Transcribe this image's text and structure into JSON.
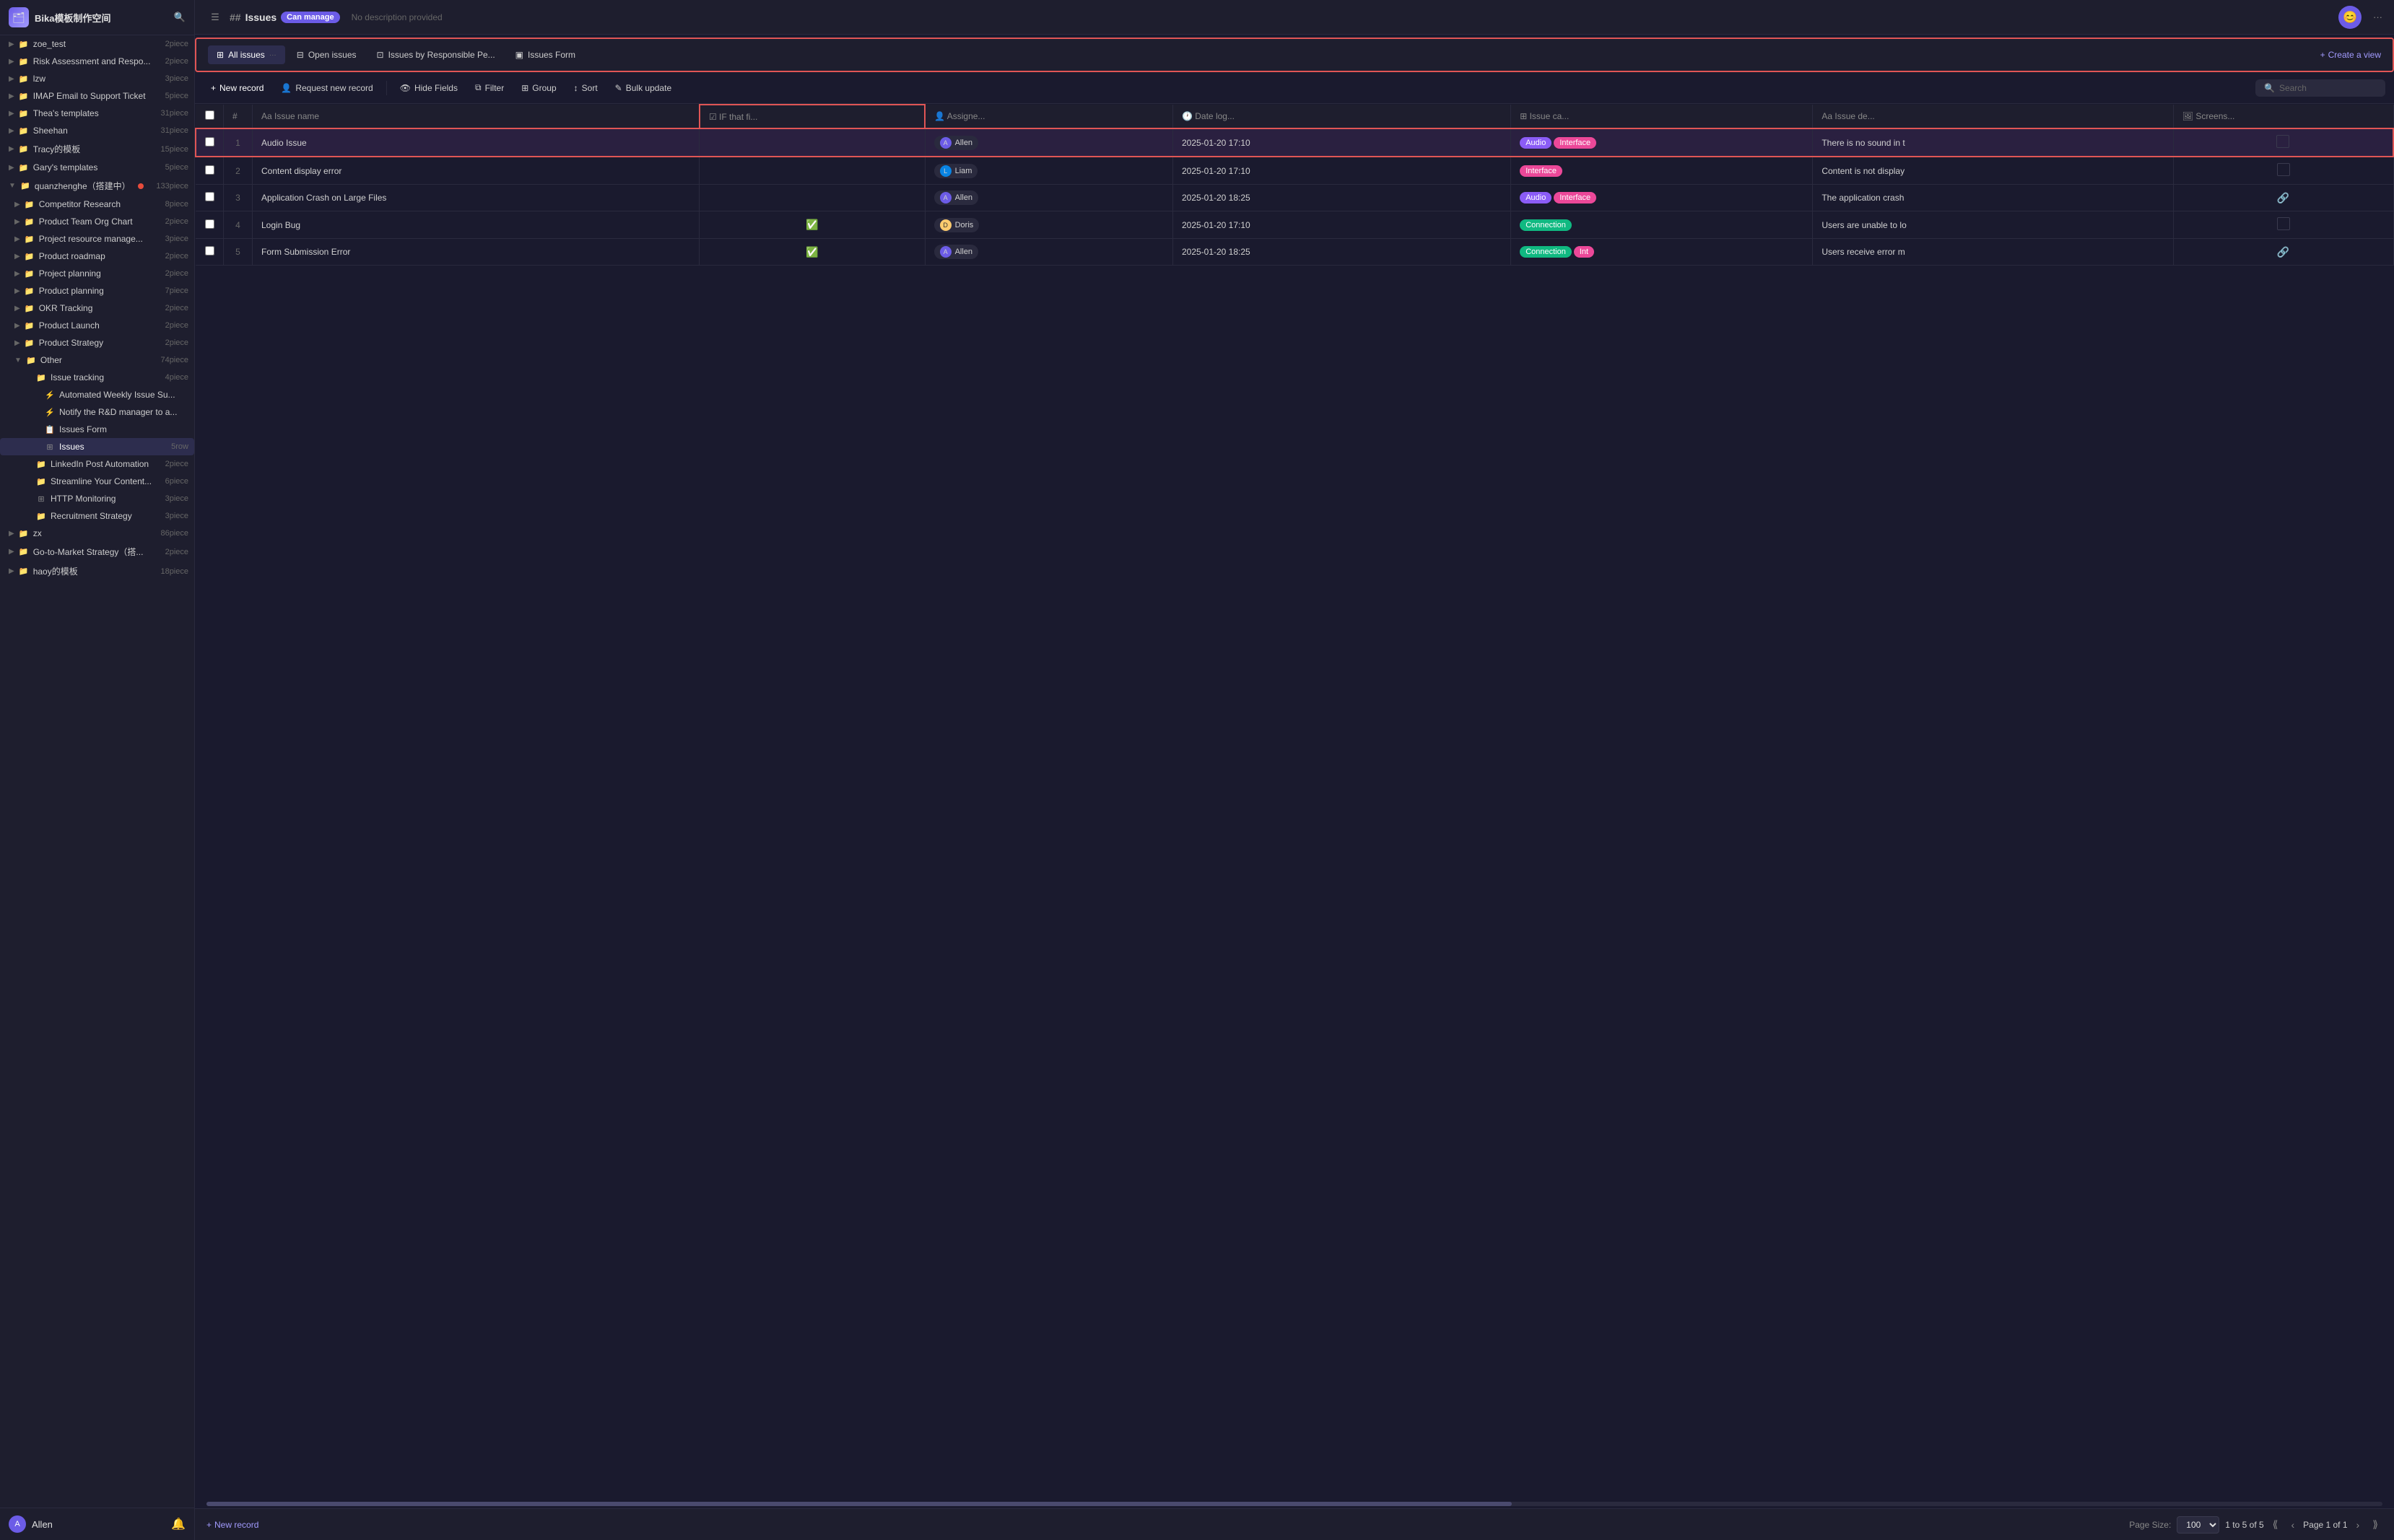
{
  "sidebar": {
    "workspace": "Bika模板制作空间",
    "items": [
      {
        "id": "zoe_test",
        "label": "zoe_test",
        "count": "2piece",
        "indent": 0,
        "icon": "folder"
      },
      {
        "id": "risk",
        "label": "Risk Assessment and Respo...",
        "count": "2piece",
        "indent": 0,
        "icon": "folder"
      },
      {
        "id": "lzw",
        "label": "lzw",
        "count": "3piece",
        "indent": 0,
        "icon": "folder"
      },
      {
        "id": "imap",
        "label": "IMAP Email to Support Ticket",
        "count": "5piece",
        "indent": 0,
        "icon": "folder"
      },
      {
        "id": "thea",
        "label": "Thea's templates",
        "count": "31piece",
        "indent": 0,
        "icon": "folder"
      },
      {
        "id": "sheehan",
        "label": "Sheehan",
        "count": "31piece",
        "indent": 0,
        "icon": "folder"
      },
      {
        "id": "tracy",
        "label": "Tracy的模板",
        "count": "15piece",
        "indent": 0,
        "icon": "folder"
      },
      {
        "id": "gary",
        "label": "Gary's templates",
        "count": "5piece",
        "indent": 0,
        "icon": "folder"
      },
      {
        "id": "quanzhenghe",
        "label": "quanzhenghe（搭建中）",
        "count": "133piece",
        "indent": 0,
        "icon": "folder",
        "expanded": true,
        "dot": true
      },
      {
        "id": "competitor",
        "label": "Competitor Research",
        "count": "8piece",
        "indent": 1,
        "icon": "folder"
      },
      {
        "id": "product-team",
        "label": "Product Team Org Chart",
        "count": "2piece",
        "indent": 1,
        "icon": "folder"
      },
      {
        "id": "project-res",
        "label": "Project resource manage...",
        "count": "3piece",
        "indent": 1,
        "icon": "folder"
      },
      {
        "id": "product-road",
        "label": "Product roadmap",
        "count": "2piece",
        "indent": 1,
        "icon": "folder"
      },
      {
        "id": "project-plan",
        "label": "Project planning",
        "count": "2piece",
        "indent": 1,
        "icon": "folder"
      },
      {
        "id": "product-plan",
        "label": "Product planning",
        "count": "7piece",
        "indent": 1,
        "icon": "folder"
      },
      {
        "id": "okr",
        "label": "OKR Tracking",
        "count": "2piece",
        "indent": 1,
        "icon": "folder"
      },
      {
        "id": "product-launch",
        "label": "Product Launch",
        "count": "2piece",
        "indent": 1,
        "icon": "folder"
      },
      {
        "id": "product-strategy",
        "label": "Product Strategy",
        "count": "2piece",
        "indent": 1,
        "icon": "folder"
      },
      {
        "id": "other",
        "label": "Other",
        "count": "74piece",
        "indent": 1,
        "icon": "folder",
        "expanded": true
      },
      {
        "id": "issue-tracking",
        "label": "Issue tracking",
        "count": "4piece",
        "indent": 2,
        "icon": "folder",
        "expanded": true
      },
      {
        "id": "automated-weekly",
        "label": "Automated Weekly Issue Su...",
        "count": "",
        "indent": 3,
        "icon": "automation"
      },
      {
        "id": "notify-rd",
        "label": "Notify the R&D manager to a...",
        "count": "",
        "indent": 3,
        "icon": "automation"
      },
      {
        "id": "issues-form",
        "label": "Issues Form",
        "count": "",
        "indent": 3,
        "icon": "form"
      },
      {
        "id": "issues",
        "label": "Issues",
        "count": "5row",
        "indent": 3,
        "icon": "grid",
        "active": true
      },
      {
        "id": "linkedin",
        "label": "LinkedIn Post Automation",
        "count": "2piece",
        "indent": 2,
        "icon": "folder"
      },
      {
        "id": "streamline",
        "label": "Streamline Your Content...",
        "count": "6piece",
        "indent": 2,
        "icon": "folder"
      },
      {
        "id": "http-monitoring",
        "label": "HTTP Monitoring",
        "count": "3piece",
        "indent": 2,
        "icon": "grid"
      },
      {
        "id": "recruitment",
        "label": "Recruitment Strategy",
        "count": "3piece",
        "indent": 2,
        "icon": "folder"
      },
      {
        "id": "zx",
        "label": "zx",
        "count": "86piece",
        "indent": 0,
        "icon": "folder"
      },
      {
        "id": "go-to-market",
        "label": "Go-to-Market Strategy（搭...",
        "count": "2piece",
        "indent": 0,
        "icon": "folder"
      },
      {
        "id": "haoyide",
        "label": "haoy的模板",
        "count": "18piece",
        "indent": 0,
        "icon": "folder"
      }
    ],
    "user": "Allen",
    "notification_dot": true
  },
  "header": {
    "title": "Issues",
    "badge": "Can manage",
    "description": "No description provided",
    "more_icon": "···"
  },
  "views": {
    "tabs": [
      {
        "id": "all-issues",
        "label": "All issues",
        "icon": "grid",
        "active": true,
        "dots": "···"
      },
      {
        "id": "open-issues",
        "label": "Open issues",
        "icon": "grid"
      },
      {
        "id": "issues-by-resp",
        "label": "Issues by Responsible Pe...",
        "icon": "layout"
      },
      {
        "id": "issues-form",
        "label": "Issues Form",
        "icon": "form"
      }
    ],
    "create_view": "Create a view"
  },
  "toolbar": {
    "new_record": "New record",
    "request_new_record": "Request new record",
    "hide_fields": "Hide Fields",
    "filter": "Filter",
    "group": "Group",
    "sort": "Sort",
    "bulk_update": "Bulk update",
    "search_placeholder": "Search"
  },
  "table": {
    "columns": [
      {
        "id": "issue-name",
        "label": "Issue name",
        "icon": "text"
      },
      {
        "id": "if-that-fi",
        "label": "IF that fi...",
        "icon": "checkbox"
      },
      {
        "id": "assignee",
        "label": "Assigne...",
        "icon": "person"
      },
      {
        "id": "date-log",
        "label": "Date log...",
        "icon": "clock"
      },
      {
        "id": "issue-ca",
        "label": "Issue ca...",
        "icon": "tag"
      },
      {
        "id": "issue-de",
        "label": "Issue de...",
        "icon": "text"
      },
      {
        "id": "screens",
        "label": "Screens...",
        "icon": "image"
      }
    ],
    "rows": [
      {
        "num": 1,
        "issue_name": "Audio Issue",
        "if_field": "",
        "assignee": "Allen",
        "assignee_avatar": "allen",
        "date": "2025-01-20 17:10",
        "category": [
          "Audio",
          "Interface"
        ],
        "description": "There is no sound in t",
        "has_screen": false,
        "highlighted": true
      },
      {
        "num": 2,
        "issue_name": "Content display error",
        "if_field": "",
        "assignee": "Liam",
        "assignee_avatar": "liam",
        "date": "2025-01-20 17:10",
        "category": [
          "Interface"
        ],
        "description": "Content is not display",
        "has_screen": false,
        "highlighted": false
      },
      {
        "num": 3,
        "issue_name": "Application Crash on Large Files",
        "if_field": "",
        "assignee": "Allen",
        "assignee_avatar": "allen",
        "date": "2025-01-20 18:25",
        "category": [
          "Audio",
          "Interface"
        ],
        "description": "The application crash",
        "has_screen": true,
        "highlighted": false
      },
      {
        "num": 4,
        "issue_name": "Login Bug",
        "if_field": "check",
        "assignee": "Doris",
        "assignee_avatar": "doris",
        "date": "2025-01-20 17:10",
        "category": [
          "Connection"
        ],
        "description": "Users are unable to lo",
        "has_screen": false,
        "highlighted": false
      },
      {
        "num": 5,
        "issue_name": "Form Submission Error",
        "if_field": "check",
        "assignee": "Allen",
        "assignee_avatar": "allen",
        "date": "2025-01-20 18:25",
        "category": [
          "Connection",
          "Int"
        ],
        "description": "Users receive error m",
        "has_screen": true,
        "highlighted": false
      }
    ]
  },
  "footer": {
    "new_record": "New record",
    "page_size_label": "Page Size:",
    "page_size": "100",
    "pagination_info": "1 to 5 of 5",
    "page_info": "Page 1 of 1"
  }
}
